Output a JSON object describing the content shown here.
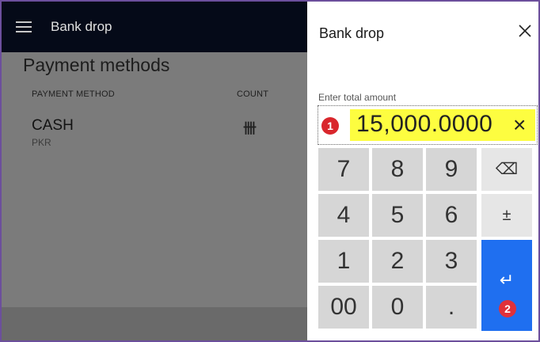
{
  "header": {
    "menu_icon": "hamburger-icon",
    "title": "Bank drop"
  },
  "main": {
    "page_title": "Payment methods",
    "columns": [
      "PAYMENT METHOD",
      "COUNT"
    ],
    "rows": [
      {
        "name": "CASH",
        "currency": "PKR",
        "count_glyph": "卌"
      }
    ]
  },
  "dialog": {
    "title": "Bank drop",
    "close_icon": "close-icon",
    "amount_label": "Enter total amount",
    "amount_value": "15,000.0000",
    "clear_glyph": "×",
    "badge1": "1",
    "badge2": "2",
    "keys": {
      "k7": "7",
      "k8": "8",
      "k9": "9",
      "backspace": "⌫",
      "k4": "4",
      "k5": "5",
      "k6": "6",
      "plusminus": "±",
      "k1": "1",
      "k2": "2",
      "k3": "3",
      "k00": "00",
      "k0": "0",
      "dot": ".",
      "enter": "↵"
    }
  },
  "colors": {
    "accent_blue": "#1f6ff0",
    "highlight_yellow": "#fdfd40",
    "badge_red": "#d9262c"
  }
}
